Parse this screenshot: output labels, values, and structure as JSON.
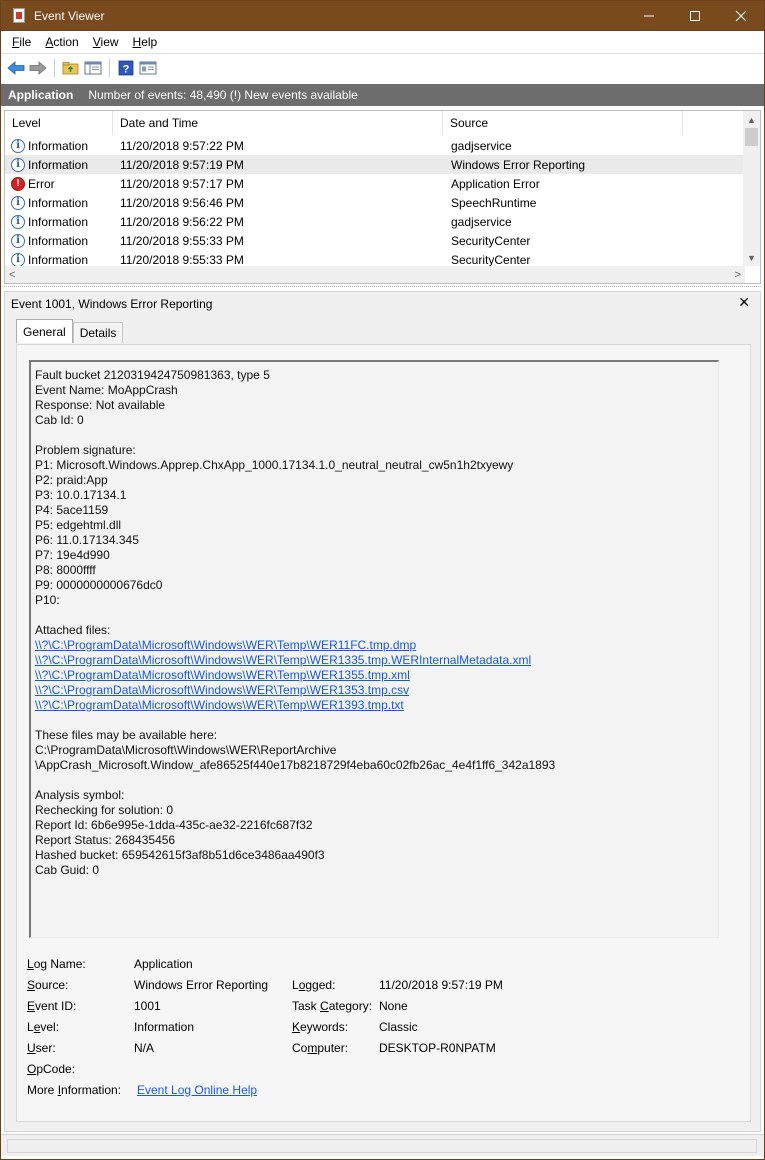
{
  "window": {
    "title": "Event Viewer",
    "controls": {
      "minimize": "─",
      "maximize": "☐",
      "close": "✕"
    }
  },
  "menu": [
    {
      "key": "F",
      "rest": "ile"
    },
    {
      "key": "A",
      "rest": "ction"
    },
    {
      "key": "V",
      "rest": "iew"
    },
    {
      "key": "H",
      "rest": "elp"
    }
  ],
  "toolbar": {
    "icons": [
      "back-arrow-icon",
      "forward-arrow-icon",
      "folder-up-icon",
      "show-hide-tree-icon",
      "help-icon",
      "properties-icon"
    ]
  },
  "header": {
    "log": "Application",
    "status": "Number of events: 48,490 (!) New events available"
  },
  "event_list": {
    "columns": [
      "Level",
      "Date and Time",
      "Source"
    ],
    "rows": [
      {
        "level": "Information",
        "datetime": "11/20/2018 9:57:22 PM",
        "source": "gadjservice",
        "type": "info"
      },
      {
        "level": "Information",
        "datetime": "11/20/2018 9:57:19 PM",
        "source": "Windows Error Reporting",
        "type": "info"
      },
      {
        "level": "Error",
        "datetime": "11/20/2018 9:57:17 PM",
        "source": "Application Error",
        "type": "error"
      },
      {
        "level": "Information",
        "datetime": "11/20/2018 9:56:46 PM",
        "source": "SpeechRuntime",
        "type": "info"
      },
      {
        "level": "Information",
        "datetime": "11/20/2018 9:56:22 PM",
        "source": "gadjservice",
        "type": "info"
      },
      {
        "level": "Information",
        "datetime": "11/20/2018 9:55:33 PM",
        "source": "SecurityCenter",
        "type": "info"
      },
      {
        "level": "Information",
        "datetime": "11/20/2018 9:55:33 PM",
        "source": "SecurityCenter",
        "type": "info"
      }
    ],
    "selected_row": 1
  },
  "detail": {
    "title": "Event 1001, Windows Error Reporting",
    "close": "✕",
    "tabs": [
      "General",
      "Details"
    ],
    "active_tab": "General",
    "description_lines": [
      {
        "text": "Fault bucket 2120319424750981363, type 5"
      },
      {
        "text": "Event Name: MoAppCrash"
      },
      {
        "text": "Response: Not available"
      },
      {
        "text": "Cab Id: 0"
      },
      {
        "text": ""
      },
      {
        "text": "Problem signature:"
      },
      {
        "text": "P1: Microsoft.Windows.Apprep.ChxApp_1000.17134.1.0_neutral_neutral_cw5n1h2txyewy"
      },
      {
        "text": "P2: praid:App"
      },
      {
        "text": "P3: 10.0.17134.1"
      },
      {
        "text": "P4: 5ace1159"
      },
      {
        "text": "P5: edgehtml.dll"
      },
      {
        "text": "P6: 11.0.17134.345"
      },
      {
        "text": "P7: 19e4d990"
      },
      {
        "text": "P8: 8000ffff"
      },
      {
        "text": "P9: 0000000000676dc0"
      },
      {
        "text": "P10:"
      },
      {
        "text": ""
      },
      {
        "text": "Attached files:"
      },
      {
        "text": "\\\\?\\C:\\ProgramData\\Microsoft\\Windows\\WER\\Temp\\WER11FC.tmp.dmp",
        "link": true
      },
      {
        "text": "\\\\?\\C:\\ProgramData\\Microsoft\\Windows\\WER\\Temp\\WER1335.tmp.WERInternalMetadata.xml",
        "link": true
      },
      {
        "text": "\\\\?\\C:\\ProgramData\\Microsoft\\Windows\\WER\\Temp\\WER1355.tmp.xml",
        "link": true
      },
      {
        "text": "\\\\?\\C:\\ProgramData\\Microsoft\\Windows\\WER\\Temp\\WER1353.tmp.csv",
        "link": true
      },
      {
        "text": "\\\\?\\C:\\ProgramData\\Microsoft\\Windows\\WER\\Temp\\WER1393.tmp.txt",
        "link": true
      },
      {
        "text": ""
      },
      {
        "text": "These files may be available here:"
      },
      {
        "text": "C:\\ProgramData\\Microsoft\\Windows\\WER\\ReportArchive"
      },
      {
        "text": "\\AppCrash_Microsoft.Window_afe86525f440e17b8218729f4eba60c02fb26ac_4e4f1ff6_342a1893"
      },
      {
        "text": ""
      },
      {
        "text": "Analysis symbol:"
      },
      {
        "text": "Rechecking for solution: 0"
      },
      {
        "text": "Report Id: 6b6e995e-1dda-435c-ae32-2216fc687f32"
      },
      {
        "text": "Report Status: 268435456"
      },
      {
        "text": "Hashed bucket: 659542615f3af8b51d6ce3486aa490f3"
      },
      {
        "text": "Cab Guid: 0"
      }
    ],
    "properties": {
      "log_name_label": "Log Name:",
      "log_name_key": "L",
      "log_name_value": "Application",
      "source_label_key": "S",
      "source_label_rest": "ource:",
      "source_value": "Windows Error Reporting",
      "logged_label_key": "L",
      "logged_label_rest": "ogged:",
      "logged_value": "11/20/2018 9:57:19 PM",
      "event_id_label_key": "E",
      "event_id_label_rest": "vent ID:",
      "event_id_value": "1001",
      "task_label_key": "T",
      "task_label_rest": "ask Category:",
      "task_value": "None",
      "level_label_key": "L",
      "level_label_rest": "evel:",
      "level_value": "Information",
      "keywords_label_key": "K",
      "keywords_label_rest": "eywords:",
      "keywords_value": "Classic",
      "user_label_key": "U",
      "user_label_rest": "ser:",
      "user_value": "N/A",
      "computer_label_key": "C",
      "computer_label_rest": "omputer:",
      "computer_value": "DESKTOP-R0NPATM",
      "opcode_label_key": "O",
      "opcode_label_rest": "pCode:",
      "more_info_label_pre": "More ",
      "more_info_label_key": "I",
      "more_info_label_rest": "nformation:",
      "more_info_link": "Event Log Online Help"
    }
  },
  "colors": {
    "titlebar": "#7a4a1f",
    "header_strip": "#6d6d6d",
    "link": "#1a5bd3",
    "error": "#d32222"
  }
}
